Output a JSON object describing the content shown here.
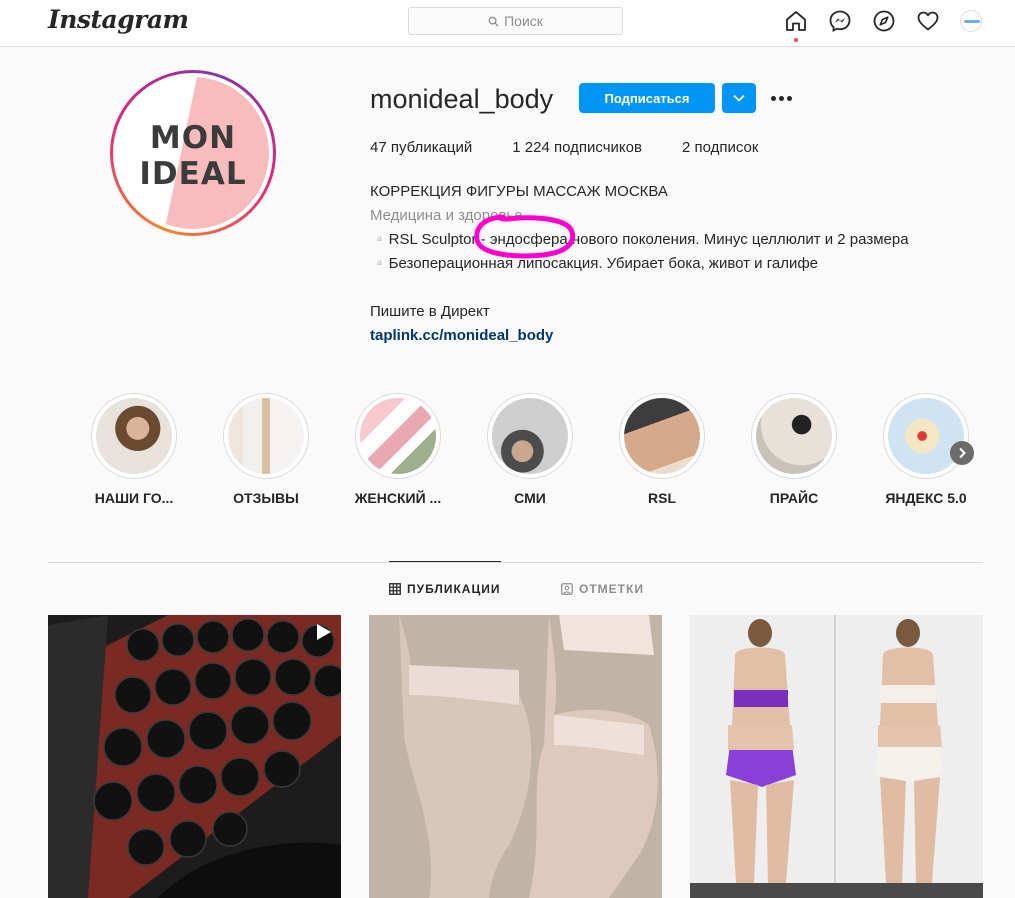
{
  "nav": {
    "logo": "Instagram",
    "search_placeholder": "Поиск",
    "icons": [
      "home-icon",
      "messenger-icon",
      "explore-icon",
      "heart-icon",
      "profile-avatar"
    ]
  },
  "profile": {
    "username": "monideal_body",
    "avatar_text_line1": "MON",
    "avatar_text_line2": "IDEAL",
    "follow_label": "Подписаться",
    "stats": {
      "posts": "47 публикаций",
      "followers": "1 224 подписчиков",
      "following": "2 подписок"
    },
    "bio": {
      "title": "КОРРЕКЦИЯ ФИГУРЫ МАССАЖ МОСКВА",
      "category": "Медицина и здоровье",
      "line1": "▫️RSL Sculptor - эндосфера нового поколения. Минус целлюлит и 2 размера",
      "line2": "▫️Безоперационная липосакция. Убирает бока, живот и галифе",
      "line3": "Пишите в Директ",
      "link": "taplink.cc/monideal_body"
    }
  },
  "highlights": [
    {
      "label": "НАШИ ГО..."
    },
    {
      "label": "ОТЗЫВЫ"
    },
    {
      "label": "ЖЕНСКИЙ ..."
    },
    {
      "label": "СМИ"
    },
    {
      "label": "RSL"
    },
    {
      "label": "ПРАЙС"
    },
    {
      "label": "ЯНДЕКС 5.0"
    }
  ],
  "tabs": {
    "posts": "ПУБЛИКАЦИИ",
    "tagged": "ОТМЕТКИ"
  },
  "colors": {
    "accent": "#0095f6",
    "annotation": "#ff00cc"
  }
}
